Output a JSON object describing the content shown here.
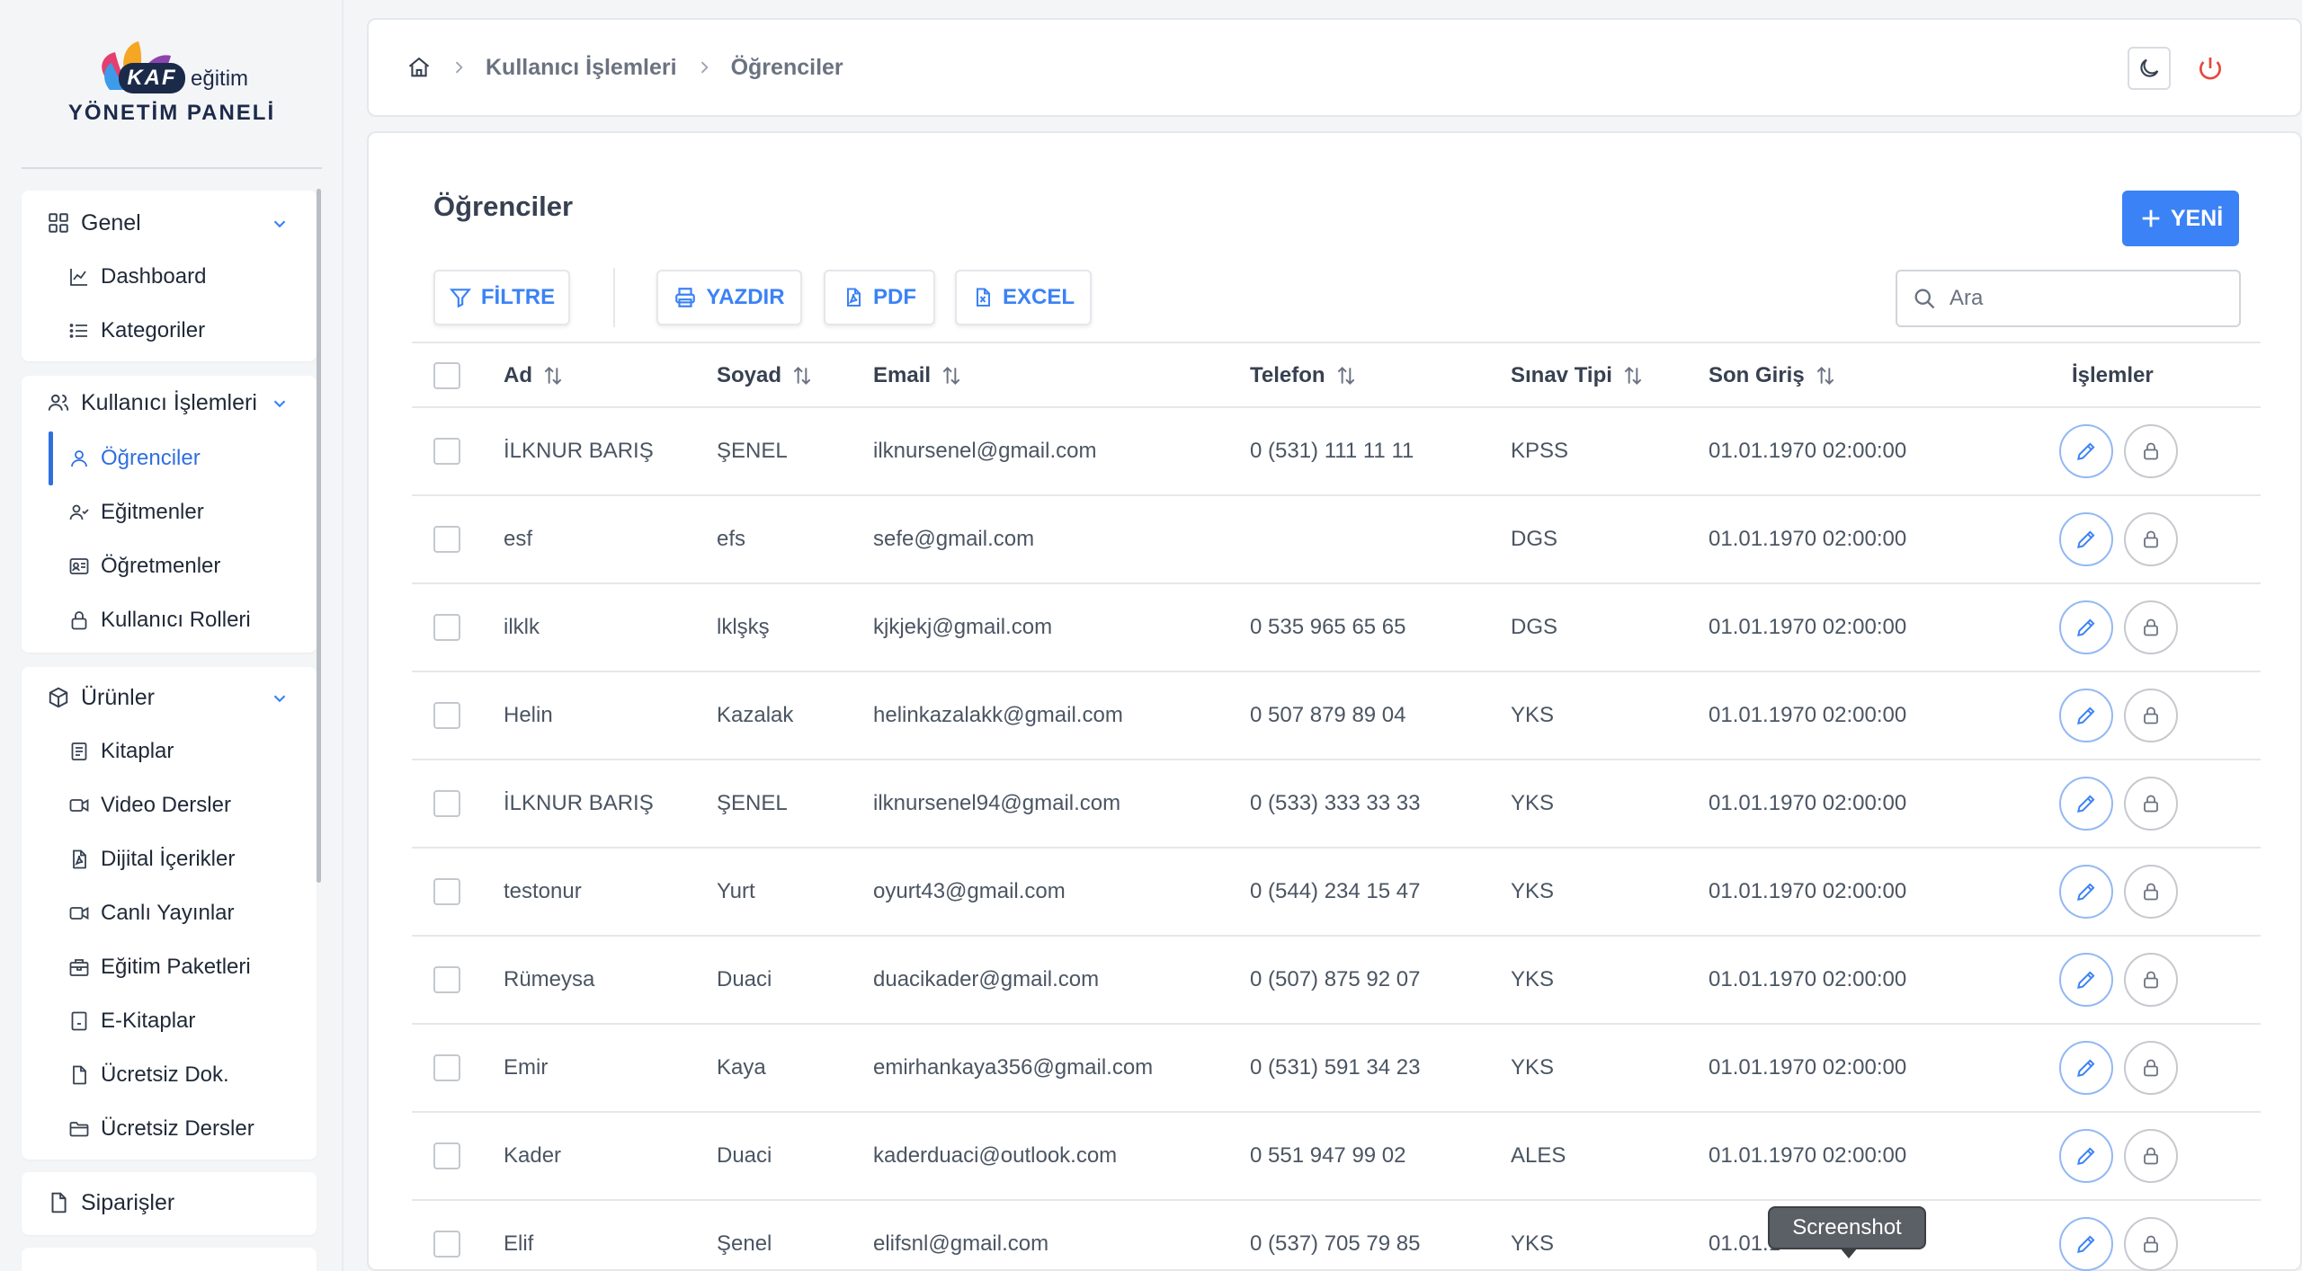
{
  "brand": {
    "mark": "KAF",
    "word": "eğitim",
    "panel": "YÖNETİM PANELİ"
  },
  "sidebar": {
    "groups": [
      {
        "label": "Genel",
        "icon": "grid-icon",
        "items": [
          {
            "label": "Dashboard",
            "icon": "chart-line-icon"
          },
          {
            "label": "Kategoriler",
            "icon": "list-icon"
          }
        ]
      },
      {
        "label": "Kullanıcı İşlemleri",
        "icon": "users-icon",
        "items": [
          {
            "label": "Öğrenciler",
            "icon": "user-icon",
            "active": true
          },
          {
            "label": "Eğitmenler",
            "icon": "user-check-icon"
          },
          {
            "label": "Öğretmenler",
            "icon": "id-card-icon"
          },
          {
            "label": "Kullanıcı Rolleri",
            "icon": "lock-icon"
          }
        ]
      },
      {
        "label": "Ürünler",
        "icon": "box-icon",
        "items": [
          {
            "label": "Kitaplar",
            "icon": "book-icon"
          },
          {
            "label": "Video Dersler",
            "icon": "video-icon"
          },
          {
            "label": "Dijital İçerikler",
            "icon": "file-icon"
          },
          {
            "label": "Canlı Yayınlar",
            "icon": "video-icon"
          },
          {
            "label": "Eğitim Paketleri",
            "icon": "package-icon"
          },
          {
            "label": "E-Kitaplar",
            "icon": "ebook-icon"
          },
          {
            "label": "Ücretsiz Dok.",
            "icon": "doc-icon"
          },
          {
            "label": "Ücretsiz Dersler",
            "icon": "folder-icon"
          }
        ]
      },
      {
        "label": "Siparişler",
        "icon": "doc-icon",
        "items": []
      }
    ]
  },
  "breadcrumb": {
    "items": [
      "Kullanıcı İşlemleri",
      "Öğrenciler"
    ]
  },
  "page": {
    "title": "Öğrenciler",
    "new_label": "YENİ",
    "filter_label": "FİLTRE",
    "print_label": "YAZDIR",
    "pdf_label": "PDF",
    "excel_label": "EXCEL",
    "search_placeholder": "Ara"
  },
  "table": {
    "columns": [
      "Ad",
      "Soyad",
      "Email",
      "Telefon",
      "Sınav Tipi",
      "Son Giriş",
      "İşlemler"
    ],
    "rows": [
      [
        "İLKNUR BARIŞ",
        "ŞENEL",
        "ilknursenel@gmail.com",
        "0 (531) 111 11 11",
        "KPSS",
        "01.01.1970 02:00:00"
      ],
      [
        "esf",
        "efs",
        "sefe@gmail.com",
        "",
        "DGS",
        "01.01.1970 02:00:00"
      ],
      [
        "ilklk",
        "lklşkş",
        "kjkjekj@gmail.com",
        "0 535 965 65 65",
        "DGS",
        "01.01.1970 02:00:00"
      ],
      [
        "Helin",
        "Kazalak",
        "helinkazalakk@gmail.com",
        "0 507 879 89 04",
        "YKS",
        "01.01.1970 02:00:00"
      ],
      [
        "İLKNUR BARIŞ",
        "ŞENEL",
        "ilknursenel94@gmail.com",
        "0 (533) 333 33 33",
        "YKS",
        "01.01.1970 02:00:00"
      ],
      [
        "testonur",
        "Yurt",
        "oyurt43@gmail.com",
        "0 (544) 234 15 47",
        "YKS",
        "01.01.1970 02:00:00"
      ],
      [
        "Rümeysa",
        "Duaci",
        "duacikader@gmail.com",
        "0 (507) 875 92 07",
        "YKS",
        "01.01.1970 02:00:00"
      ],
      [
        "Emir",
        "Kaya",
        "emirhankaya356@gmail.com",
        "0 (531) 591 34 23",
        "YKS",
        "01.01.1970 02:00:00"
      ],
      [
        "Kader",
        "Duaci",
        "kaderduaci@outlook.com",
        "0 551 947 99 02",
        "ALES",
        "01.01.1970 02:00:00"
      ],
      [
        "Elif",
        "Şenel",
        "elifsnl@gmail.com",
        "0 (537) 705 79 85",
        "YKS",
        "01.01.1"
      ]
    ]
  },
  "tooltip": "Screenshot",
  "colors": {
    "accent": "#3b82f6",
    "active_nav": "#2f6fe0",
    "power": "#e5483b"
  }
}
